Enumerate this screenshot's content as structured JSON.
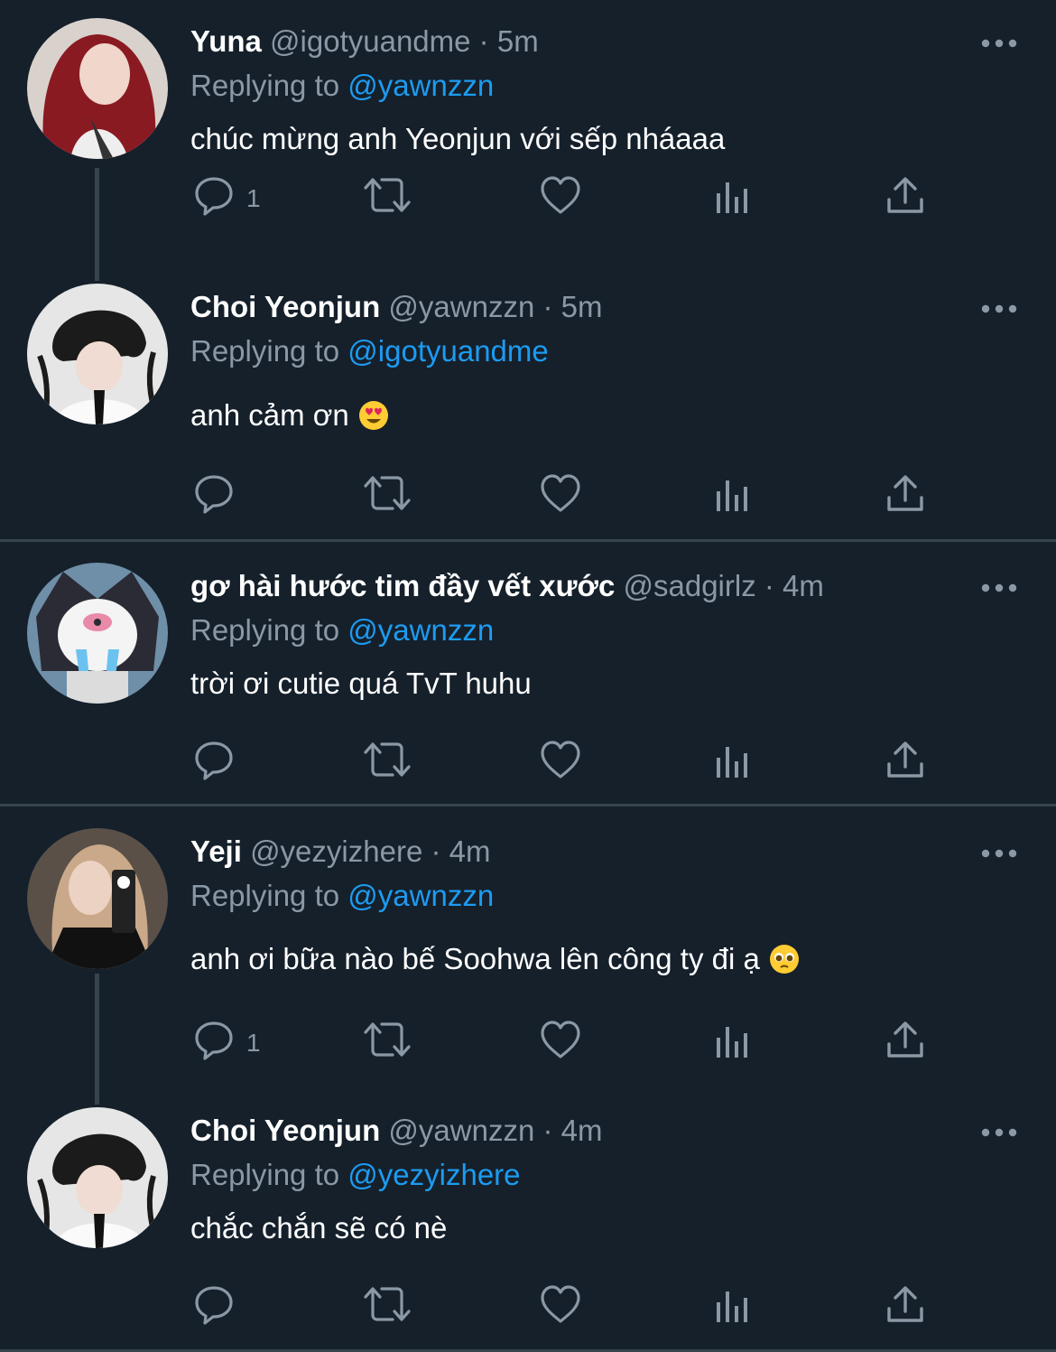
{
  "colors": {
    "background": "#15202b",
    "text": "#ffffff",
    "muted": "#8b98a5",
    "link": "#1d9bf0",
    "line": "#38444d"
  },
  "tweets": [
    {
      "name": "Yuna",
      "handle": "@igotyuandme",
      "dot": "·",
      "time": "5m",
      "replying_label": "Replying to",
      "replying_to": "@yawnzzn",
      "text": "chúc mừng anh Yeonjun với sếp nháaaa",
      "reply_count": "1",
      "emoji": ""
    },
    {
      "name": "Choi Yeonjun",
      "handle": "@yawnzzn",
      "dot": "·",
      "time": "5m",
      "replying_label": "Replying to",
      "replying_to": "@igotyuandme",
      "text": "anh cảm ơn",
      "reply_count": "",
      "emoji": "heart-eyes-emoji"
    },
    {
      "name": "gơ hài hước tim đầy vết xước",
      "handle": "@sadgirlz",
      "dot": "·",
      "time": "4m",
      "replying_label": "Replying to",
      "replying_to": "@yawnzzn",
      "text": "trời ơi cutie quá TvT huhu",
      "reply_count": "",
      "emoji": ""
    },
    {
      "name": "Yeji",
      "handle": "@yezyizhere",
      "dot": "·",
      "time": "4m",
      "replying_label": "Replying to",
      "replying_to": "@yawnzzn",
      "text": "anh ơi bữa nào bế Soohwa lên công ty đi ạ",
      "reply_count": "1",
      "emoji": "pleading-face-emoji"
    },
    {
      "name": "Choi Yeonjun",
      "handle": "@yawnzzn",
      "dot": "·",
      "time": "4m",
      "replying_label": "Replying to",
      "replying_to": "@yezyizhere",
      "text": "chắc chắn sẽ có nè",
      "reply_count": "",
      "emoji": ""
    }
  ]
}
